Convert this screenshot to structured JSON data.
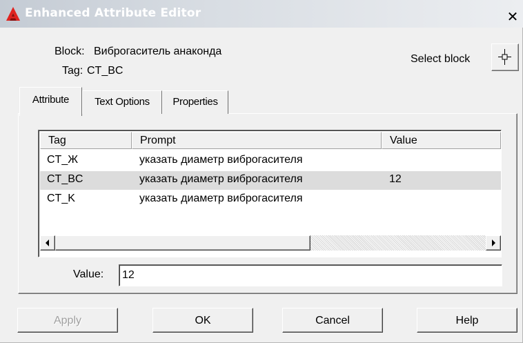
{
  "window": {
    "title": "Enhanced Attribute Editor",
    "close_glyph": "✕"
  },
  "info": {
    "block_label": "Block:",
    "block_name": "Виброгаситель анаконда",
    "tag_label": "Tag:",
    "tag_name": "CT_BC",
    "select_block_label": "Select block"
  },
  "tabs": [
    {
      "label": "Attribute",
      "active": true
    },
    {
      "label": "Text Options",
      "active": false
    },
    {
      "label": "Properties",
      "active": false
    }
  ],
  "attribute_list": {
    "columns": [
      "Tag",
      "Prompt",
      "Value"
    ],
    "rows": [
      {
        "tag": "CT_Ж",
        "prompt": "указать диаметр виброгасителя",
        "value": "",
        "selected": false
      },
      {
        "tag": "CT_BC",
        "prompt": "указать диаметр виброгасителя",
        "value": "12",
        "selected": true
      },
      {
        "tag": "CT_K",
        "prompt": "указать диаметр виброгасителя",
        "value": "",
        "selected": false
      }
    ]
  },
  "value_field": {
    "label": "Value:",
    "value": "12"
  },
  "buttons": {
    "apply": "Apply",
    "ok": "OK",
    "cancel": "Cancel",
    "help": "Help"
  },
  "icons": {
    "app_icon": "autocad-a-icon",
    "pick_icon": "crosshair-icon",
    "scroll_left": "triangle-left-icon",
    "scroll_right": "triangle-right-icon"
  },
  "colors": {
    "app_icon_red": "#e0231f",
    "selected_row": "#dcdcdc",
    "title_gradient_start": "#c4cbd4"
  }
}
